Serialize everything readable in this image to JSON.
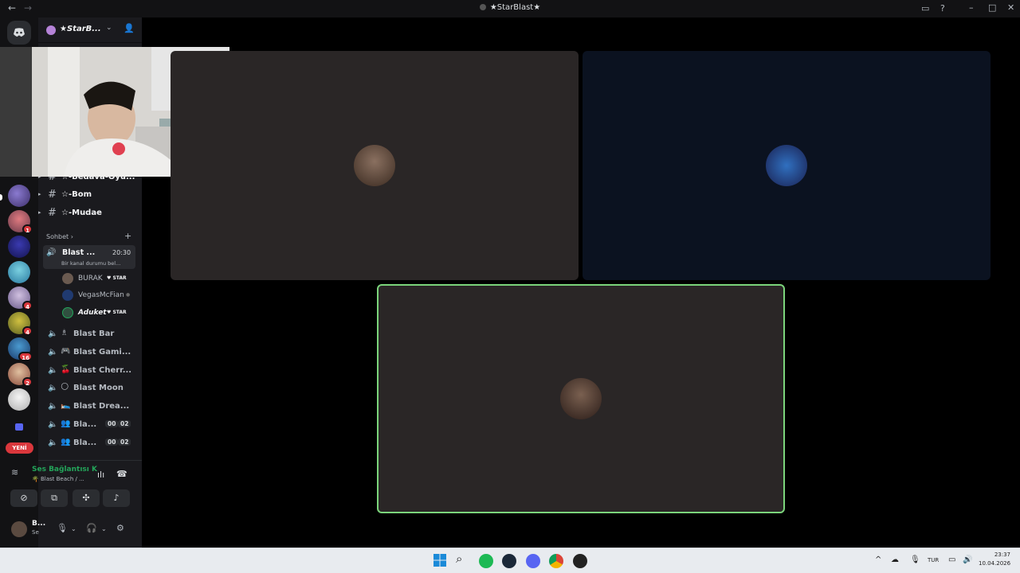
{
  "window": {
    "title": "★StarBlast★",
    "back_icon": "←",
    "forward_icon": "→"
  },
  "server": {
    "name": "★StarB...",
    "unread_label": "YENİ",
    "badges": [
      "1",
      "4",
      "4",
      "16",
      "2"
    ]
  },
  "channels": [
    {
      "name": "☆-Bedava-Oyu..."
    },
    {
      "name": "☆-Bom"
    },
    {
      "name": "☆-Mudae"
    }
  ],
  "category": {
    "name": "Sohbet"
  },
  "active_voice": {
    "name": "Blast ...",
    "time": "20:30",
    "status": "Bir kanal durumu bel..."
  },
  "members": [
    {
      "name": "BURAK",
      "tag": "STAR"
    },
    {
      "name": "VegasMcFian",
      "tag": ""
    },
    {
      "name": "Aduket",
      "tag": "STAR"
    }
  ],
  "voice_channels": [
    {
      "name": "Blast Bar",
      "emoji": "♗"
    },
    {
      "name": "Blast Gami...",
      "emoji": "🎮"
    },
    {
      "name": "Blast Cherr...",
      "emoji": "🍒"
    },
    {
      "name": "Blast Moon",
      "emoji": "🌕"
    },
    {
      "name": "Blast Drea...",
      "emoji": "🛌"
    },
    {
      "name": "Bla...",
      "emoji": "👥",
      "count_a": "00",
      "count_b": "02"
    },
    {
      "name": "Bla...",
      "emoji": "👥",
      "count_a": "00",
      "count_b": "02"
    }
  ],
  "voice_panel": {
    "connection": "Ses Bağlantısı K",
    "channel": "🌴 Blast Beach / ..."
  },
  "user": {
    "name": "B...",
    "status": "Se"
  },
  "taskbar": {
    "language": "TUR",
    "time": "23:37",
    "date": "10.04.2026"
  },
  "colors": {
    "accent_green": "#23a55a",
    "badge_red": "#da373c",
    "speaking_border": "#7bd47b"
  }
}
